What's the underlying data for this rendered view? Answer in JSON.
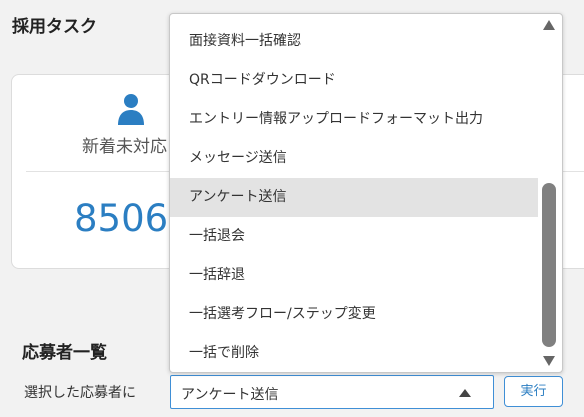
{
  "header": {
    "title": "採用タスク"
  },
  "card": {
    "icon": "person-icon",
    "label": "新着未対応",
    "count": "8506"
  },
  "applicants": {
    "title": "応募者一覧",
    "select_label": "選択した応募者に",
    "selected_value": "アンケート送信",
    "run_label": "実行"
  },
  "dropdown": {
    "options": [
      "面接資料一括確認",
      "QRコードダウンロード",
      "エントリー情報アップロードフォーマット出力",
      "メッセージ送信",
      "アンケート送信",
      "一括退会",
      "一括辞退",
      "一括選考フロー/ステップ変更",
      "一括で削除"
    ],
    "selected_option": "アンケート送信"
  },
  "colors": {
    "accent": "#2b7ec2",
    "border_accent": "#3f8fd6",
    "highlight": "#e3e3e3"
  }
}
